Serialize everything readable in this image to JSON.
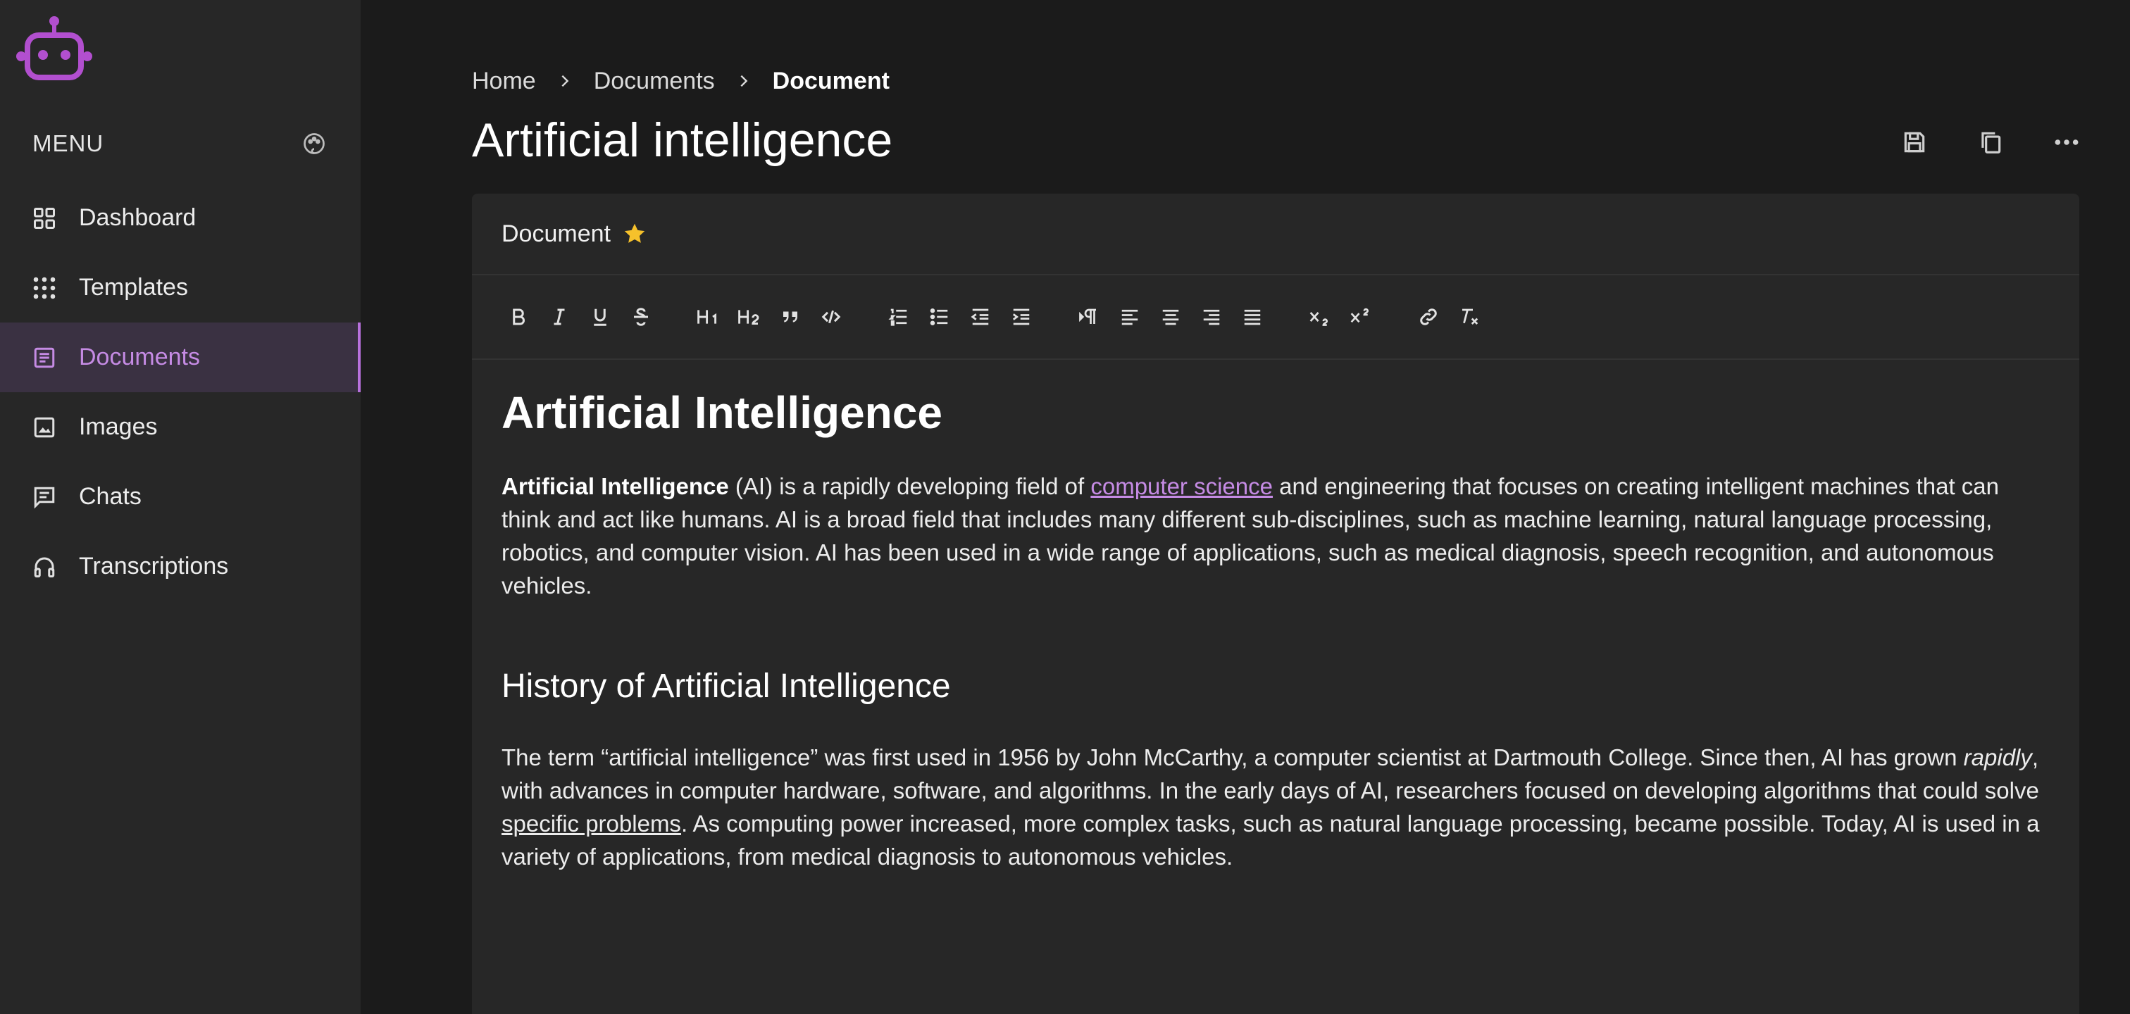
{
  "sidebar": {
    "logo_icon": "robot-icon",
    "menu_title": "MENU",
    "theme_icon": "palette-icon",
    "items": [
      {
        "label": "Dashboard",
        "icon": "grid-icon"
      },
      {
        "label": "Templates",
        "icon": "dots-grid-icon"
      },
      {
        "label": "Documents",
        "icon": "document-icon",
        "active": true
      },
      {
        "label": "Images",
        "icon": "image-icon"
      },
      {
        "label": "Chats",
        "icon": "chat-icon"
      },
      {
        "label": "Transcriptions",
        "icon": "headphones-icon"
      }
    ]
  },
  "breadcrumb": [
    "Home",
    "Documents",
    "Document"
  ],
  "page_title": "Artificial intelligence",
  "header_actions": [
    "save-icon",
    "copy-icon",
    "more-icon"
  ],
  "card": {
    "title": "Document",
    "starred": true
  },
  "toolbar": {
    "groups": [
      [
        "bold",
        "italic",
        "underline",
        "strikethrough"
      ],
      [
        "heading-1",
        "heading-2",
        "blockquote",
        "code"
      ],
      [
        "ordered-list",
        "bullet-list",
        "outdent",
        "indent"
      ],
      [
        "text-direction",
        "align-left",
        "align-center",
        "align-right",
        "justify"
      ],
      [
        "subscript",
        "superscript"
      ],
      [
        "link",
        "clear-format"
      ]
    ]
  },
  "document": {
    "heading": "Artificial Intelligence",
    "p1_bold": "Artificial Intelligence",
    "p1_a": " (AI) is a rapidly developing field of ",
    "p1_link": "computer science",
    "p1_b": " and engineering that focuses on creating intelligent machines that can think and act like humans. AI is a broad field that includes many different sub-disciplines, such as machine learning, natural language processing, robotics, and computer vision. AI has been used in a wide range of applications, such as medical diagnosis, speech recognition, and autonomous vehicles.",
    "subheading": "History of Artificial Intelligence",
    "p2_a": "The term “artificial intelligence” was first used in 1956 by John McCarthy, a computer scientist at Dartmouth College. Since then, AI has grown ",
    "p2_italic": "rapidly",
    "p2_b": ", with advances in computer hardware, software, and algorithms. In the early days of AI, researchers focused on developing algorithms that could solve ",
    "p2_underline": "specific problems",
    "p2_c": ". As computing power increased, more complex tasks, such as natural language processing, became possible. Today, AI is used in a variety of applications, from medical diagnosis to autonomous vehicles."
  },
  "colors": {
    "accent": "#c58be4",
    "star": "#f6c12b",
    "background": "#1b1b1b",
    "panel": "#272727"
  }
}
